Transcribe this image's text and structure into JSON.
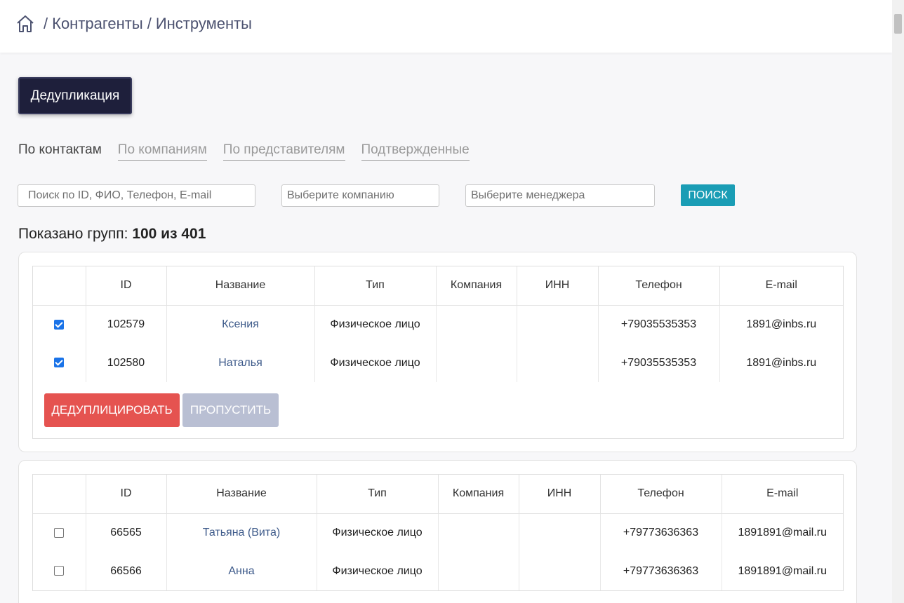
{
  "breadcrumb": {
    "home_icon": "home-icon",
    "separator": "/",
    "items": [
      "Контрагенты",
      "Инструменты"
    ]
  },
  "dedup_button": "Дедупликация",
  "tabs": [
    {
      "label": "По контактам",
      "active": true
    },
    {
      "label": "По компаниям",
      "active": false
    },
    {
      "label": "По представителям",
      "active": false
    },
    {
      "label": "Подтвержденные",
      "active": false
    }
  ],
  "filters": {
    "search_placeholder": "Поиск по ID, ФИО, Телефон, E-mail",
    "company_placeholder": "Выберите компанию",
    "manager_placeholder": "Выберите менеджера",
    "search_button": "ПОИСК"
  },
  "groups_count": {
    "prefix": "Показано групп:",
    "value": "100 из 401"
  },
  "table_headers": [
    "",
    "ID",
    "Название",
    "Тип",
    "Компания",
    "ИНН",
    "Телефон",
    "E-mail"
  ],
  "groups": [
    {
      "rows": [
        {
          "checked": true,
          "id": "102579",
          "name": "Ксения",
          "type": "Физическое лицо",
          "company": "",
          "inn": "",
          "phone": "+79035535353",
          "email": "1891@inbs.ru"
        },
        {
          "checked": true,
          "id": "102580",
          "name": "Наталья",
          "type": "Физическое лицо",
          "company": "",
          "inn": "",
          "phone": "+79035535353",
          "email": "1891@inbs.ru"
        }
      ],
      "actions": {
        "dedup": "ДЕДУПЛИЦИРОВАТЬ",
        "skip": "ПРОПУСТИТЬ"
      }
    },
    {
      "rows": [
        {
          "checked": false,
          "id": "66565",
          "name": "Татьяна (Вита)",
          "type": "Физическое лицо",
          "company": "",
          "inn": "",
          "phone": "+79773636363",
          "email": "1891891@mail.ru"
        },
        {
          "checked": false,
          "id": "66566",
          "name": "Анна",
          "type": "Физическое лицо",
          "company": "",
          "inn": "",
          "phone": "+79773636363",
          "email": "1891891@mail.ru"
        }
      ]
    }
  ],
  "colors": {
    "dark_button": "#1e1f3b",
    "search_button": "#1a9db5",
    "dedup_red": "#e55350",
    "skip_grey": "#b9bfd3",
    "link": "#3d5a8a"
  }
}
